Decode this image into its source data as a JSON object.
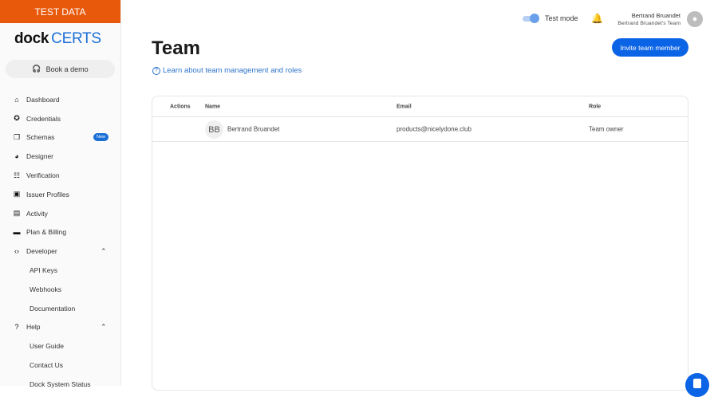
{
  "banner": "TEST DATA",
  "logo": {
    "dock": "dock",
    "certs": "CERTS"
  },
  "book_demo": "Book a demo",
  "nav": [
    {
      "label": "Dashboard",
      "icon": "⌂"
    },
    {
      "label": "Credentials",
      "icon": "✪"
    },
    {
      "label": "Schemas",
      "icon": "❐",
      "badge": "New"
    },
    {
      "label": "Designer",
      "icon": "◕"
    },
    {
      "label": "Verification",
      "icon": "☷"
    },
    {
      "label": "Issuer Profiles",
      "icon": "▣"
    },
    {
      "label": "Activity",
      "icon": "▤"
    },
    {
      "label": "Plan & Billing",
      "icon": "▬"
    },
    {
      "label": "Developer",
      "icon": "‹›"
    },
    {
      "label": "API Keys"
    },
    {
      "label": "Webhooks"
    },
    {
      "label": "Documentation"
    },
    {
      "label": "Help",
      "icon": "?"
    },
    {
      "label": "User Guide"
    },
    {
      "label": "Contact Us"
    },
    {
      "label": "Dock System Status"
    }
  ],
  "header": {
    "test_mode": "Test mode",
    "user_name": "Bertrand Bruandet",
    "team_name": "Bertrand Bruandet's Team"
  },
  "page": {
    "title": "Team",
    "learn_link": "Learn about team management and roles",
    "invite_button": "Invite team member"
  },
  "table": {
    "columns": [
      "Actions",
      "Name",
      "Email",
      "Role"
    ],
    "rows": [
      {
        "initials": "BB",
        "name": "Bertrand Bruandet",
        "email": "products@nicelydone.club",
        "role": "Team owner"
      }
    ]
  },
  "colors": {
    "accent": "#0b63e5",
    "banner": "#e8590c"
  }
}
